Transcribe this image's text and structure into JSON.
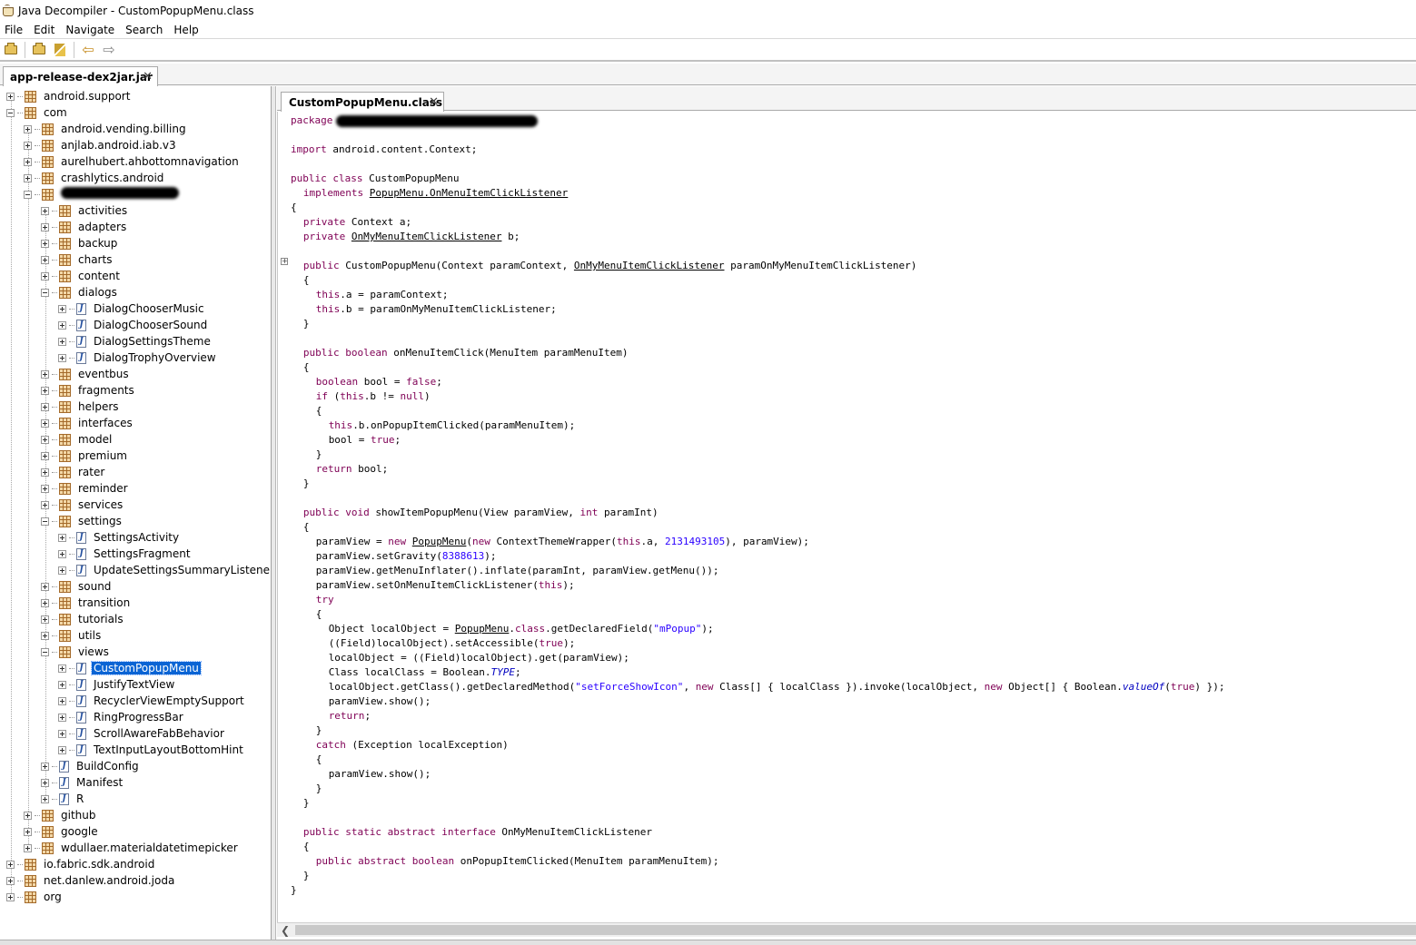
{
  "window": {
    "title": "Java Decompiler - CustomPopupMenu.class"
  },
  "menubar": [
    "File",
    "Edit",
    "Navigate",
    "Search",
    "Help"
  ],
  "toolbar": {
    "icons": [
      "open-file-icon",
      "flashlight-icon",
      "back-arrow-icon",
      "forward-arrow-icon"
    ]
  },
  "file_tab": {
    "label": "app-release-dex2jar.jar"
  },
  "tree": [
    {
      "label": "android.support",
      "depth": 0,
      "type": "package",
      "expanded": false
    },
    {
      "label": "com",
      "depth": 0,
      "type": "package",
      "expanded": true
    },
    {
      "label": "android.vending.billing",
      "depth": 1,
      "type": "package",
      "expanded": false
    },
    {
      "label": "anjlab.android.iab.v3",
      "depth": 1,
      "type": "package",
      "expanded": false
    },
    {
      "label": "aurelhubert.ahbottomnavigation",
      "depth": 1,
      "type": "package",
      "expanded": false
    },
    {
      "label": "crashlytics.android",
      "depth": 1,
      "type": "package",
      "expanded": false
    },
    {
      "label": "",
      "depth": 1,
      "type": "package",
      "expanded": true,
      "redacted": true
    },
    {
      "label": "activities",
      "depth": 2,
      "type": "package",
      "expanded": false
    },
    {
      "label": "adapters",
      "depth": 2,
      "type": "package",
      "expanded": false
    },
    {
      "label": "backup",
      "depth": 2,
      "type": "package",
      "expanded": false
    },
    {
      "label": "charts",
      "depth": 2,
      "type": "package",
      "expanded": false
    },
    {
      "label": "content",
      "depth": 2,
      "type": "package",
      "expanded": false
    },
    {
      "label": "dialogs",
      "depth": 2,
      "type": "package",
      "expanded": true
    },
    {
      "label": "DialogChooserMusic",
      "depth": 3,
      "type": "class",
      "expanded": false
    },
    {
      "label": "DialogChooserSound",
      "depth": 3,
      "type": "class",
      "expanded": false
    },
    {
      "label": "DialogSettingsTheme",
      "depth": 3,
      "type": "class",
      "expanded": false
    },
    {
      "label": "DialogTrophyOverview",
      "depth": 3,
      "type": "class",
      "expanded": false
    },
    {
      "label": "eventbus",
      "depth": 2,
      "type": "package",
      "expanded": false
    },
    {
      "label": "fragments",
      "depth": 2,
      "type": "package",
      "expanded": false
    },
    {
      "label": "helpers",
      "depth": 2,
      "type": "package",
      "expanded": false
    },
    {
      "label": "interfaces",
      "depth": 2,
      "type": "package",
      "expanded": false
    },
    {
      "label": "model",
      "depth": 2,
      "type": "package",
      "expanded": false
    },
    {
      "label": "premium",
      "depth": 2,
      "type": "package",
      "expanded": false
    },
    {
      "label": "rater",
      "depth": 2,
      "type": "package",
      "expanded": false
    },
    {
      "label": "reminder",
      "depth": 2,
      "type": "package",
      "expanded": false
    },
    {
      "label": "services",
      "depth": 2,
      "type": "package",
      "expanded": false
    },
    {
      "label": "settings",
      "depth": 2,
      "type": "package",
      "expanded": true
    },
    {
      "label": "SettingsActivity",
      "depth": 3,
      "type": "class",
      "expanded": false
    },
    {
      "label": "SettingsFragment",
      "depth": 3,
      "type": "class",
      "expanded": false
    },
    {
      "label": "UpdateSettingsSummaryListener",
      "depth": 3,
      "type": "class",
      "expanded": false
    },
    {
      "label": "sound",
      "depth": 2,
      "type": "package",
      "expanded": false
    },
    {
      "label": "transition",
      "depth": 2,
      "type": "package",
      "expanded": false
    },
    {
      "label": "tutorials",
      "depth": 2,
      "type": "package",
      "expanded": false
    },
    {
      "label": "utils",
      "depth": 2,
      "type": "package",
      "expanded": false
    },
    {
      "label": "views",
      "depth": 2,
      "type": "package",
      "expanded": true
    },
    {
      "label": "CustomPopupMenu",
      "depth": 3,
      "type": "class",
      "expanded": false,
      "selected": true
    },
    {
      "label": "JustifyTextView",
      "depth": 3,
      "type": "class",
      "expanded": false
    },
    {
      "label": "RecyclerViewEmptySupport",
      "depth": 3,
      "type": "class",
      "expanded": false
    },
    {
      "label": "RingProgressBar",
      "depth": 3,
      "type": "class",
      "expanded": false
    },
    {
      "label": "ScrollAwareFabBehavior",
      "depth": 3,
      "type": "class",
      "expanded": false
    },
    {
      "label": "TextInputLayoutBottomHint",
      "depth": 3,
      "type": "class",
      "expanded": false
    },
    {
      "label": "BuildConfig",
      "depth": 2,
      "type": "class",
      "expanded": false
    },
    {
      "label": "Manifest",
      "depth": 2,
      "type": "class",
      "expanded": false
    },
    {
      "label": "R",
      "depth": 2,
      "type": "class",
      "expanded": false
    },
    {
      "label": "github",
      "depth": 1,
      "type": "package",
      "expanded": false
    },
    {
      "label": "google",
      "depth": 1,
      "type": "package",
      "expanded": false
    },
    {
      "label": "wdullaer.materialdatetimepicker",
      "depth": 1,
      "type": "package",
      "expanded": false
    },
    {
      "label": "io.fabric.sdk.android",
      "depth": 0,
      "type": "package",
      "expanded": false
    },
    {
      "label": "net.danlew.android.joda",
      "depth": 0,
      "type": "package",
      "expanded": false
    },
    {
      "label": "org",
      "depth": 0,
      "type": "package",
      "expanded": false
    }
  ],
  "editor_tab": {
    "label": "CustomPopupMenu.class"
  },
  "code": {
    "lines": [
      {
        "slot": 0,
        "indent": 0,
        "parts": [
          [
            "kw",
            "package"
          ],
          [
            "redact",
            ""
          ]
        ]
      },
      {
        "slot": 2,
        "indent": 0,
        "parts": [
          [
            "kw",
            "import"
          ],
          [
            "t",
            " android.content.Context;"
          ]
        ]
      },
      {
        "slot": 4,
        "indent": 0,
        "parts": [
          [
            "kw",
            "public class"
          ],
          [
            "t",
            " CustomPopupMenu"
          ]
        ]
      },
      {
        "slot": 5,
        "indent": 2,
        "parts": [
          [
            "kw",
            "implements"
          ],
          [
            "t",
            " "
          ],
          [
            "ul",
            "PopupMenu.OnMenuItemClickListener"
          ]
        ]
      },
      {
        "slot": 6,
        "indent": 0,
        "parts": [
          [
            "t",
            "{"
          ]
        ]
      },
      {
        "slot": 7,
        "indent": 2,
        "parts": [
          [
            "kw",
            "private"
          ],
          [
            "t",
            " Context a;"
          ]
        ]
      },
      {
        "slot": 8,
        "indent": 2,
        "parts": [
          [
            "kw",
            "private"
          ],
          [
            "t",
            " "
          ],
          [
            "ul",
            "OnMyMenuItemClickListener"
          ],
          [
            "t",
            " b;"
          ]
        ]
      },
      {
        "slot": 10,
        "indent": 2,
        "parts": [
          [
            "kw",
            "public"
          ],
          [
            "t",
            " CustomPopupMenu(Context paramContext, "
          ],
          [
            "ul",
            "OnMyMenuItemClickListener"
          ],
          [
            "t",
            " paramOnMyMenuItemClickListener)"
          ]
        ]
      },
      {
        "slot": 11,
        "indent": 2,
        "parts": [
          [
            "t",
            "{"
          ]
        ]
      },
      {
        "slot": 12,
        "indent": 4,
        "parts": [
          [
            "kw",
            "this"
          ],
          [
            "t",
            ".a = paramContext;"
          ]
        ]
      },
      {
        "slot": 13,
        "indent": 4,
        "parts": [
          [
            "kw",
            "this"
          ],
          [
            "t",
            ".b = paramOnMyMenuItemClickListener;"
          ]
        ]
      },
      {
        "slot": 14,
        "indent": 2,
        "parts": [
          [
            "t",
            "}"
          ]
        ]
      },
      {
        "slot": 16,
        "indent": 2,
        "parts": [
          [
            "kw",
            "public boolean"
          ],
          [
            "t",
            " onMenuItemClick(MenuItem paramMenuItem)"
          ]
        ]
      },
      {
        "slot": 17,
        "indent": 2,
        "parts": [
          [
            "t",
            "{"
          ]
        ]
      },
      {
        "slot": 18,
        "indent": 4,
        "parts": [
          [
            "kw",
            "boolean"
          ],
          [
            "t",
            " bool = "
          ],
          [
            "kw",
            "false"
          ],
          [
            "t",
            ";"
          ]
        ]
      },
      {
        "slot": 19,
        "indent": 4,
        "parts": [
          [
            "kw",
            "if"
          ],
          [
            "t",
            " ("
          ],
          [
            "kw",
            "this"
          ],
          [
            "t",
            ".b != "
          ],
          [
            "kw",
            "null"
          ],
          [
            "t",
            ")"
          ]
        ]
      },
      {
        "slot": 20,
        "indent": 4,
        "parts": [
          [
            "t",
            "{"
          ]
        ]
      },
      {
        "slot": 21,
        "indent": 6,
        "parts": [
          [
            "kw",
            "this"
          ],
          [
            "t",
            ".b.onPopupItemClicked(paramMenuItem);"
          ]
        ]
      },
      {
        "slot": 22,
        "indent": 6,
        "parts": [
          [
            "t",
            "bool = "
          ],
          [
            "kw",
            "true"
          ],
          [
            "t",
            ";"
          ]
        ]
      },
      {
        "slot": 23,
        "indent": 4,
        "parts": [
          [
            "t",
            "}"
          ]
        ]
      },
      {
        "slot": 24,
        "indent": 4,
        "parts": [
          [
            "kw",
            "return"
          ],
          [
            "t",
            " bool;"
          ]
        ]
      },
      {
        "slot": 25,
        "indent": 2,
        "parts": [
          [
            "t",
            "}"
          ]
        ]
      },
      {
        "slot": 27,
        "indent": 2,
        "parts": [
          [
            "kw",
            "public void"
          ],
          [
            "t",
            " showItemPopupMenu(View paramView, "
          ],
          [
            "kw",
            "int"
          ],
          [
            "t",
            " paramInt)"
          ]
        ]
      },
      {
        "slot": 28,
        "indent": 2,
        "parts": [
          [
            "t",
            "{"
          ]
        ]
      },
      {
        "slot": 29,
        "indent": 4,
        "parts": [
          [
            "t",
            "paramView = "
          ],
          [
            "kw",
            "new"
          ],
          [
            "t",
            " "
          ],
          [
            "ul",
            "PopupMenu"
          ],
          [
            "t",
            "("
          ],
          [
            "kw",
            "new"
          ],
          [
            "t",
            " ContextThemeWrapper("
          ],
          [
            "kw",
            "this"
          ],
          [
            "t",
            ".a, "
          ],
          [
            "lit",
            "2131493105"
          ],
          [
            "t",
            "), paramView);"
          ]
        ]
      },
      {
        "slot": 30,
        "indent": 4,
        "parts": [
          [
            "t",
            "paramView.setGravity("
          ],
          [
            "lit",
            "8388613"
          ],
          [
            "t",
            ");"
          ]
        ]
      },
      {
        "slot": 31,
        "indent": 4,
        "parts": [
          [
            "t",
            "paramView.getMenuInflater().inflate(paramInt, paramView.getMenu());"
          ]
        ]
      },
      {
        "slot": 32,
        "indent": 4,
        "parts": [
          [
            "t",
            "paramView.setOnMenuItemClickListener("
          ],
          [
            "kw",
            "this"
          ],
          [
            "t",
            ");"
          ]
        ]
      },
      {
        "slot": 33,
        "indent": 4,
        "parts": [
          [
            "kw",
            "try"
          ]
        ]
      },
      {
        "slot": 34,
        "indent": 4,
        "parts": [
          [
            "t",
            "{"
          ]
        ]
      },
      {
        "slot": 35,
        "indent": 6,
        "parts": [
          [
            "t",
            "Object localObject = "
          ],
          [
            "ul",
            "PopupMenu"
          ],
          [
            "t",
            "."
          ],
          [
            "kw",
            "class"
          ],
          [
            "t",
            ".getDeclaredField("
          ],
          [
            "lit",
            "\"mPopup\""
          ],
          [
            "t",
            ");"
          ]
        ]
      },
      {
        "slot": 36,
        "indent": 6,
        "parts": [
          [
            "t",
            "((Field)localObject).setAccessible("
          ],
          [
            "kw",
            "true"
          ],
          [
            "t",
            ");"
          ]
        ]
      },
      {
        "slot": 37,
        "indent": 6,
        "parts": [
          [
            "t",
            "localObject = ((Field)localObject).get(paramView);"
          ]
        ]
      },
      {
        "slot": 38,
        "indent": 6,
        "parts": [
          [
            "t",
            "Class localClass = Boolean."
          ],
          [
            "it",
            "TYPE"
          ],
          [
            "t",
            ";"
          ]
        ]
      },
      {
        "slot": 39,
        "indent": 6,
        "parts": [
          [
            "t",
            "localObject.getClass().getDeclaredMethod("
          ],
          [
            "lit",
            "\"setForceShowIcon\""
          ],
          [
            "t",
            ", "
          ],
          [
            "kw",
            "new"
          ],
          [
            "t",
            " Class[] { localClass }).invoke(localObject, "
          ],
          [
            "kw",
            "new"
          ],
          [
            "t",
            " Object[] { Boolean."
          ],
          [
            "it",
            "valueOf"
          ],
          [
            "t",
            "("
          ],
          [
            "kw",
            "true"
          ],
          [
            "t",
            ") });"
          ]
        ]
      },
      {
        "slot": 40,
        "indent": 6,
        "parts": [
          [
            "t",
            "paramView.show();"
          ]
        ]
      },
      {
        "slot": 41,
        "indent": 6,
        "parts": [
          [
            "kw",
            "return"
          ],
          [
            "t",
            ";"
          ]
        ]
      },
      {
        "slot": 42,
        "indent": 4,
        "parts": [
          [
            "t",
            "}"
          ]
        ]
      },
      {
        "slot": 43,
        "indent": 4,
        "parts": [
          [
            "kw",
            "catch"
          ],
          [
            "t",
            " (Exception localException)"
          ]
        ]
      },
      {
        "slot": 44,
        "indent": 4,
        "parts": [
          [
            "t",
            "{"
          ]
        ]
      },
      {
        "slot": 45,
        "indent": 6,
        "parts": [
          [
            "t",
            "paramView.show();"
          ]
        ]
      },
      {
        "slot": 46,
        "indent": 4,
        "parts": [
          [
            "t",
            "}"
          ]
        ]
      },
      {
        "slot": 47,
        "indent": 2,
        "parts": [
          [
            "t",
            "}"
          ]
        ]
      },
      {
        "slot": 49,
        "indent": 2,
        "parts": [
          [
            "kw",
            "public static abstract interface"
          ],
          [
            "t",
            " OnMyMenuItemClickListener"
          ]
        ]
      },
      {
        "slot": 50,
        "indent": 2,
        "parts": [
          [
            "t",
            "{"
          ]
        ]
      },
      {
        "slot": 51,
        "indent": 4,
        "parts": [
          [
            "kw",
            "public abstract boolean"
          ],
          [
            "t",
            " onPopupItemClicked(MenuItem paramMenuItem);"
          ]
        ]
      },
      {
        "slot": 52,
        "indent": 2,
        "parts": [
          [
            "t",
            "}"
          ]
        ]
      },
      {
        "slot": 53,
        "indent": 0,
        "parts": [
          [
            "t",
            "}"
          ]
        ]
      }
    ]
  }
}
